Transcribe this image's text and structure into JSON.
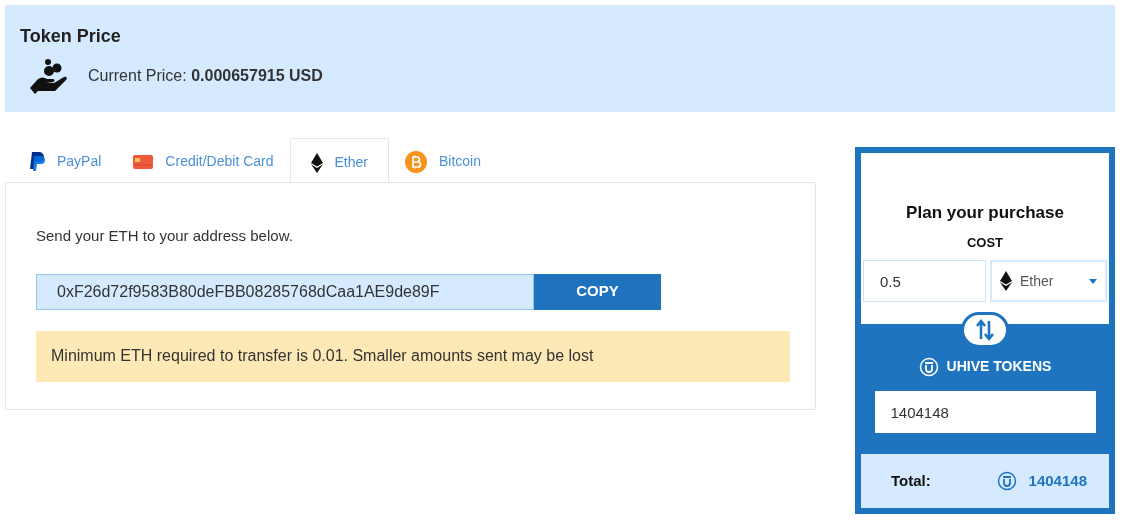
{
  "token_price": {
    "title": "Token Price",
    "current_price": "Current Price: **0.000657915 USD**"
  },
  "tabs": [
    {
      "kind": "paypal",
      "label": "PayPal",
      "selected": false
    },
    {
      "kind": "card",
      "label": "Credit/Debit Card",
      "selected": false
    },
    {
      "kind": "ether",
      "label": "Ether",
      "selected": true
    },
    {
      "kind": "bitcoin",
      "label": "Bitcoin",
      "selected": false
    }
  ],
  "panel": {
    "instruction": "Send your ETH to your address below.",
    "address": "0xF26d72f9583B80deFBB08285768dCaa1AE9de89F",
    "copy_button": "COPY",
    "warning": "Minimum ETH required to transfer is 0.01. Smaller amounts sent may be lost"
  },
  "planner": {
    "title": "Plan your purchase",
    "cost_label": "COST",
    "cost_value": "0.5",
    "currency": "Ether",
    "tokens_label": "UHIVE TOKENS",
    "tokens_value": "1404148",
    "total_label": "Total:",
    "total_value": "1404148"
  }
}
